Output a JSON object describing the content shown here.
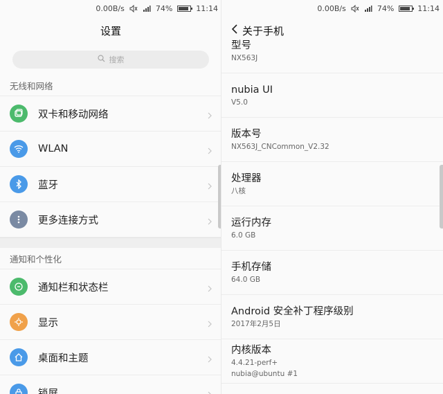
{
  "status_bar": {
    "speed": "0.00B/s",
    "battery": "74%",
    "battery_level": 0.74,
    "time": "11:14"
  },
  "settings": {
    "title": "设置",
    "search_placeholder": "搜索",
    "section_wireless": "无线和网络",
    "section_personal": "通知和个性化",
    "items_wireless": [
      {
        "label": "双卡和移动网络",
        "icon": "dual-sim-icon",
        "color": "#4cba6c"
      },
      {
        "label": "WLAN",
        "icon": "wifi-icon",
        "color": "#4a9ae8"
      },
      {
        "label": "蓝牙",
        "icon": "bluetooth-icon",
        "color": "#4a9ae8"
      },
      {
        "label": "更多连接方式",
        "icon": "more-icon",
        "color": "#7a8aa3"
      }
    ],
    "items_personal": [
      {
        "label": "通知栏和状态栏",
        "icon": "notification-icon",
        "color": "#4cba6c"
      },
      {
        "label": "显示",
        "icon": "display-icon",
        "color": "#f0a14a"
      },
      {
        "label": "桌面和主题",
        "icon": "home-icon",
        "color": "#4a9ae8"
      },
      {
        "label": "锁屏",
        "icon": "lock-icon",
        "color": "#4a9ae8"
      }
    ]
  },
  "about": {
    "title": "关于手机",
    "items": [
      {
        "label": "型号",
        "value": "NX563J"
      },
      {
        "label": "nubia UI",
        "value": "V5.0"
      },
      {
        "label": "版本号",
        "value": "NX563J_CNCommon_V2.32"
      },
      {
        "label": "处理器",
        "value": "八核"
      },
      {
        "label": "运行内存",
        "value": "6.0 GB"
      },
      {
        "label": "手机存储",
        "value": "64.0 GB"
      },
      {
        "label": "Android 安全补丁程序级别",
        "value": "2017年2月5日"
      },
      {
        "label": "内核版本",
        "value": "4.4.21-perf+",
        "value2": "nubia@ubuntu #1"
      }
    ]
  }
}
